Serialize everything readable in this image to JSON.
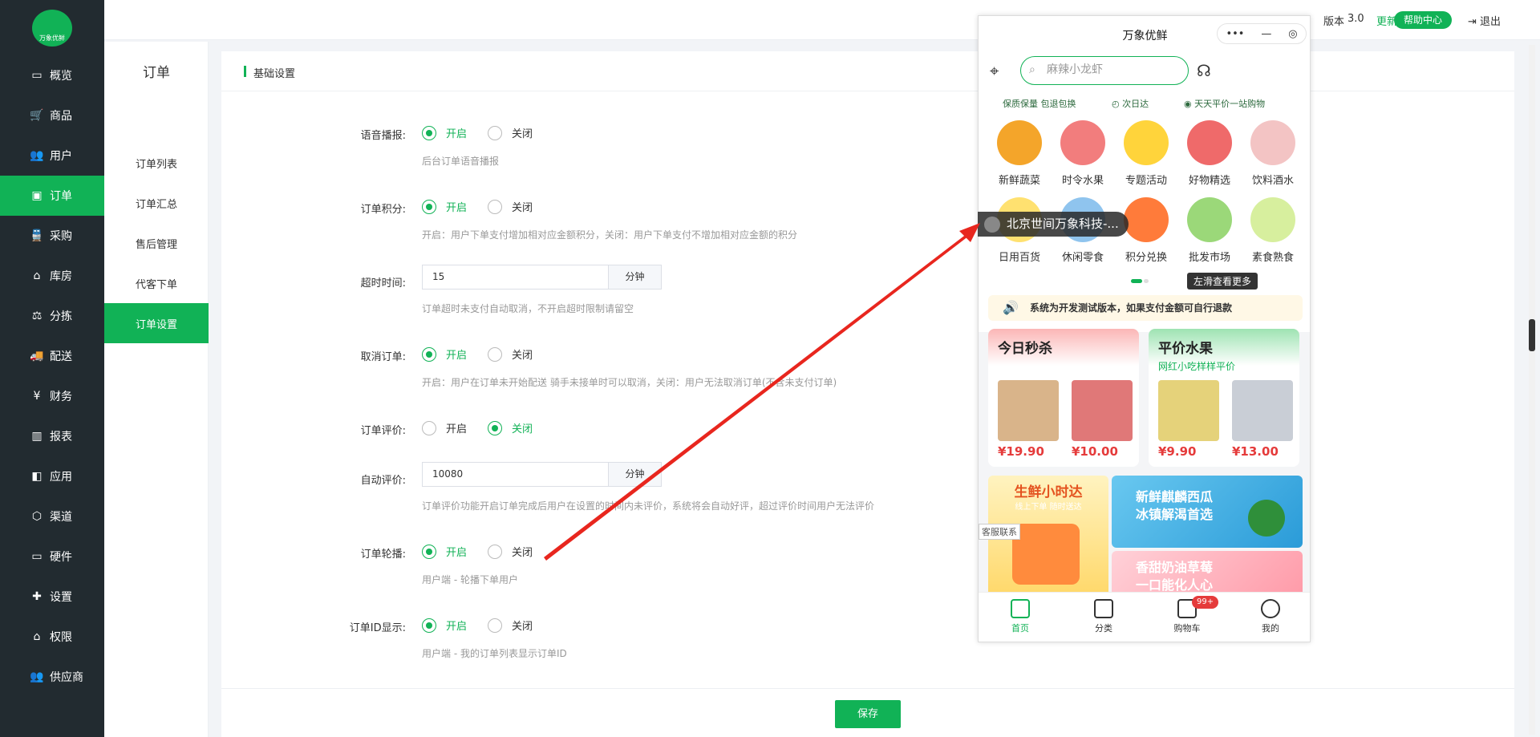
{
  "colors": {
    "accent": "#11b256",
    "sidebar_bg": "#222b30",
    "price": "#e53b3b",
    "annotation": "#e8261e"
  },
  "brand": {
    "logo_text": "万象优鲜"
  },
  "sidebar": {
    "items": [
      {
        "label": "概览",
        "icon": "monitor-icon",
        "glyph": "▭"
      },
      {
        "label": "商品",
        "icon": "cart-icon",
        "glyph": "🛒"
      },
      {
        "label": "用户",
        "icon": "users-icon",
        "glyph": "👥"
      },
      {
        "label": "订单",
        "icon": "money-icon",
        "glyph": "▣",
        "active": true
      },
      {
        "label": "采购",
        "icon": "train-icon",
        "glyph": "🚆"
      },
      {
        "label": "库房",
        "icon": "home-icon",
        "glyph": "⌂"
      },
      {
        "label": "分拣",
        "icon": "scale-icon",
        "glyph": "⚖"
      },
      {
        "label": "配送",
        "icon": "truck-icon",
        "glyph": "🚚"
      },
      {
        "label": "财务",
        "icon": "yen-icon",
        "glyph": "¥"
      },
      {
        "label": "报表",
        "icon": "bar-chart-icon",
        "glyph": "▥"
      },
      {
        "label": "应用",
        "icon": "app-icon",
        "glyph": "◧"
      },
      {
        "label": "渠道",
        "icon": "cube-icon",
        "glyph": "⬡"
      },
      {
        "label": "硬件",
        "icon": "desktop-icon",
        "glyph": "▭"
      },
      {
        "label": "设置",
        "icon": "puzzle-icon",
        "glyph": "✚"
      },
      {
        "label": "权限",
        "icon": "bank-icon",
        "glyph": "⌂"
      },
      {
        "label": "供应商",
        "icon": "supplier-icon",
        "glyph": "👥"
      }
    ]
  },
  "submenu": {
    "title": "订单",
    "items": [
      {
        "label": "订单列表"
      },
      {
        "label": "订单汇总"
      },
      {
        "label": "售后管理"
      },
      {
        "label": "代客下单"
      },
      {
        "label": "订单设置",
        "active": true
      }
    ]
  },
  "topbar": {
    "version_label": "版本",
    "version": "3.0",
    "update": "更新",
    "help": "帮助中心",
    "logout": "退出"
  },
  "card": {
    "title": "基础设置"
  },
  "radio_labels": {
    "on": "开启",
    "off": "关闭"
  },
  "settings": {
    "voice": {
      "label": "语音播报:",
      "value": "on",
      "help": "后台订单语音播报"
    },
    "points": {
      "label": "订单积分:",
      "value": "on",
      "help": "开启：用户下单支付增加相对应金额积分，关闭：用户下单支付不增加相对应金额的积分"
    },
    "timeout": {
      "label": "超时时间:",
      "input": "15",
      "unit": "分钟",
      "help": "订单超时未支付自动取消，不开启超时限制请留空"
    },
    "cancel": {
      "label": "取消订单:",
      "value": "on",
      "help": "开启：用户在订单未开始配送 骑手未接单时可以取消，关闭：用户无法取消订单(不含未支付订单)"
    },
    "review": {
      "label": "订单评价:",
      "value": "off"
    },
    "auto_review": {
      "label": "自动评价:",
      "input": "10080",
      "unit": "分钟",
      "help": "订单评价功能开启订单完成后用户在设置的时间内未评价，系统将会自动好评，超过评价时间用户无法评价"
    },
    "carousel": {
      "label": "订单轮播:",
      "value": "on",
      "help": "用户端 - 轮播下单用户"
    },
    "order_id": {
      "label": "订单ID显示:",
      "value": "on",
      "help": "用户端 - 我的订单列表显示订单ID"
    }
  },
  "save_label": "保存",
  "phone": {
    "title": "万象优鲜",
    "search_placeholder": "麻辣小龙虾",
    "tags": [
      "保质保量 包退包换",
      "次日达",
      "天天平价一站购物"
    ],
    "categories": [
      {
        "label": "新鲜蔬菜",
        "color": "#f4a52a"
      },
      {
        "label": "时令水果",
        "color": "#f27d7d"
      },
      {
        "label": "专题活动",
        "color": "#ffd43b"
      },
      {
        "label": "好物精选",
        "color": "#ef6a6a"
      },
      {
        "label": "饮料酒水",
        "color": "#f3c4c4"
      },
      {
        "label": "日用百货",
        "color": "#ffe170"
      },
      {
        "label": "休闲零食",
        "color": "#8fc4ee"
      },
      {
        "label": "积分兑换",
        "color": "#ff7b3a"
      },
      {
        "label": "批发市场",
        "color": "#9bd879"
      },
      {
        "label": "素食熟食",
        "color": "#d7ef9e"
      }
    ],
    "swipe_tip": "左滑查看更多",
    "notice": "系统为开发测试版本，如果支付金额可自行退款",
    "flash": {
      "title": "今日秒杀",
      "prices": [
        "¥19.90",
        "¥10.00"
      ]
    },
    "fruit": {
      "title": "平价水果",
      "subtitle": "网红小吃样样平价",
      "prices": [
        "¥9.90",
        "¥13.00"
      ]
    },
    "banners": {
      "fresh": "生鲜小时达",
      "fresh_sub": "线上下单 随时送达",
      "melon": "新鲜麒麟西瓜\n冰镇解渴首选",
      "berry": "香甜奶油草莓\n一口能化人心"
    },
    "service_tag": "客服联系",
    "tabs": [
      {
        "label": "首页",
        "active": true
      },
      {
        "label": "分类"
      },
      {
        "label": "购物车"
      },
      {
        "label": "我的"
      }
    ],
    "cart_badge": "99+"
  },
  "tooltip": "北京世间万象科技-..."
}
